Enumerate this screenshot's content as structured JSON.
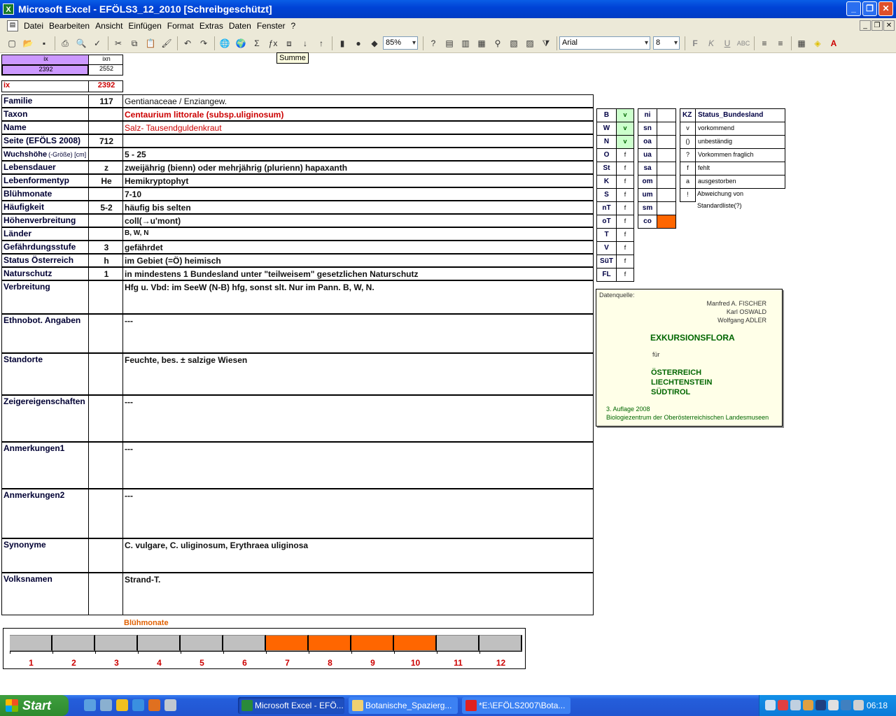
{
  "window": {
    "title": "Microsoft Excel - EFÖLS3_12_2010  [Schreibgeschützt]"
  },
  "menu": [
    "Datei",
    "Bearbeiten",
    "Ansicht",
    "Einfügen",
    "Format",
    "Extras",
    "Daten",
    "Fenster",
    "?"
  ],
  "toolbar": {
    "zoom": "85%",
    "font": "Arial",
    "size": "8",
    "tooltip": "Summe"
  },
  "index": {
    "ix_header": "ix",
    "ixn_header": "ixn",
    "ix_value": "2392",
    "ixn_value": "2552",
    "ix_label": "ix",
    "ix_value2": "2392"
  },
  "rows": [
    {
      "label": "Familie",
      "code": "117",
      "value": "Gentianaceae  /  Enziangew."
    },
    {
      "label": "Taxon",
      "code": "",
      "value": "Centaurium littorale (subsp.uliginosum)"
    },
    {
      "label": "Name",
      "code": "",
      "value": "Salz- Tausendguldenkraut"
    },
    {
      "label": "Seite (EFÖLS 2008)",
      "code": "712",
      "value": ""
    },
    {
      "label": "Wuchshöhe",
      "label_small": "(-Größe) [cm]",
      "code": "",
      "value": " 5 - 25"
    },
    {
      "label": "Lebensdauer",
      "code": "z",
      "value": "zweijährig (bienn) oder mehrjährig (plurienn) hapaxanth"
    },
    {
      "label": "Lebenformentyp",
      "code": "He",
      "value": "Hemikryptophyt"
    },
    {
      "label": "Blühmonate",
      "code": "",
      "value": " 7-10"
    },
    {
      "label": "Häufigkeit",
      "code": "5-2",
      "value": "häufig bis selten"
    },
    {
      "label": "Höhenverbreitung",
      "code": "",
      "value": "coll(→u'mont)"
    },
    {
      "label": "Länder",
      "code": "",
      "value": "B, W, N"
    },
    {
      "label": "Gefährdungsstufe",
      "code": "3",
      "value": "gefährdet"
    },
    {
      "label": "Status Österreich",
      "code": "h",
      "value": "im Gebiet (=Ö) heimisch"
    },
    {
      "label": "Naturschutz",
      "code": "1",
      "value": "in mindestens 1 Bundesland unter \"teilweisem\" gesetzlichen Naturschutz"
    },
    {
      "label": "Verbreitung",
      "code": "",
      "value": "Hfg u. Vbd: im SeeW (N-B) hfg, sonst slt. Nur im Pann. B, W, N."
    },
    {
      "label": "Ethnobot. Angaben",
      "code": "",
      "value": "---"
    },
    {
      "label": "Standorte",
      "code": "",
      "value": "Feuchte, bes. ± salzige Wiesen"
    },
    {
      "label": "Zeigereigenschaften",
      "code": "",
      "value": "---"
    },
    {
      "label": "Anmerkungen1",
      "code": "",
      "value": "---"
    },
    {
      "label": "Anmerkungen2",
      "code": "",
      "value": "---"
    },
    {
      "label": "Synonyme",
      "code": "",
      "value": "C. vulgare, C. uliginosum, Erythraea uliginosa"
    },
    {
      "label": "Volksnamen",
      "code": "",
      "value": "Strand-T."
    }
  ],
  "status_left": [
    {
      "k": "B",
      "v": "v"
    },
    {
      "k": "W",
      "v": "v"
    },
    {
      "k": "N",
      "v": "v"
    },
    {
      "k": "O",
      "v": "f"
    },
    {
      "k": "St",
      "v": "f"
    },
    {
      "k": "K",
      "v": "f"
    },
    {
      "k": "S",
      "v": "f"
    },
    {
      "k": "nT",
      "v": "f"
    },
    {
      "k": "oT",
      "v": "f"
    },
    {
      "k": "T",
      "v": "f"
    },
    {
      "k": "V",
      "v": "f"
    },
    {
      "k": "SüT",
      "v": "f"
    },
    {
      "k": "FL",
      "v": "f"
    }
  ],
  "status_mid": [
    {
      "k": "ni",
      "v": ""
    },
    {
      "k": "sn",
      "v": ""
    },
    {
      "k": "oa",
      "v": ""
    },
    {
      "k": "ua",
      "v": ""
    },
    {
      "k": "sa",
      "v": ""
    },
    {
      "k": "om",
      "v": ""
    },
    {
      "k": "um",
      "v": ""
    },
    {
      "k": "sm",
      "v": ""
    },
    {
      "k": "co",
      "v": ""
    }
  ],
  "legend": {
    "header_k": "KZ",
    "header_v": "Status_Bundesland",
    "items": [
      {
        "k": "v",
        "v": "vorkommend"
      },
      {
        "k": "()",
        "v": "unbeständig"
      },
      {
        "k": "?",
        "v": "Vorkommen fraglich"
      },
      {
        "k": "f",
        "v": "fehlt"
      },
      {
        "k": "a",
        "v": "ausgestorben"
      },
      {
        "k": "!",
        "v": "Abweichung von Standardliste(?)"
      }
    ]
  },
  "source": {
    "label": "Datenquelle:",
    "authors": [
      "Manfred A. FISCHER",
      "Karl OSWALD",
      "Wolfgang ADLER"
    ],
    "title": "EXKURSIONSFLORA",
    "fuer": "für",
    "countries": [
      "ÖSTERREICH",
      "LIECHTENSTEIN",
      "SÜDTIROL"
    ],
    "edition": "3. Auflage 2008",
    "publisher": "Biologiezentrum der Oberösterreichischen Landesmuseen"
  },
  "bluehmonate": {
    "title": "Blühmonate",
    "months": [
      "1",
      "2",
      "3",
      "4",
      "5",
      "6",
      "7",
      "8",
      "9",
      "10",
      "11",
      "12"
    ],
    "active": [
      false,
      false,
      false,
      false,
      false,
      false,
      true,
      true,
      true,
      true,
      false,
      false
    ],
    "active_color": "#ff6600",
    "inactive_color": "#c0c0c0"
  },
  "taskbar": {
    "start": "Start",
    "tasks": [
      "Microsoft Excel - EFÖ...",
      "Botanische_Spazierg...",
      "*E:\\EFÖLS2007\\Bota..."
    ],
    "clock": "06:18"
  }
}
